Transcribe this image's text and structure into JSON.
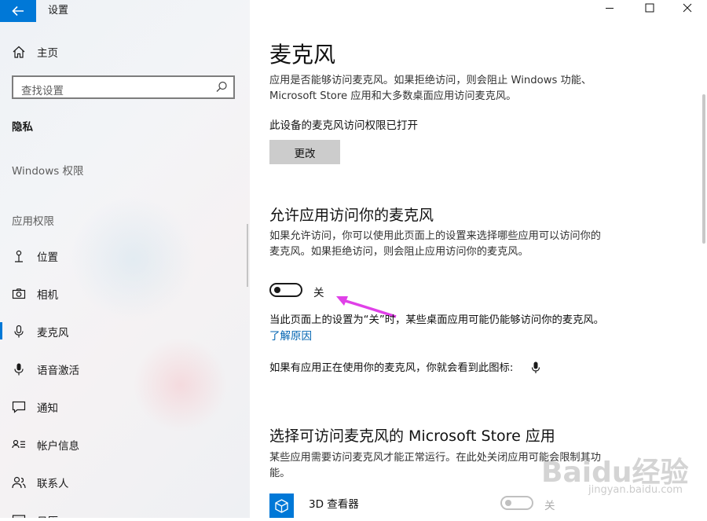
{
  "window": {
    "title": "设置"
  },
  "sidebar": {
    "home": "主页",
    "search_placeholder": "查找设置",
    "category": "隐私",
    "section_windows": "Windows 权限",
    "section_apps": "应用权限",
    "items": [
      {
        "label": "位置",
        "icon": "location-icon"
      },
      {
        "label": "相机",
        "icon": "camera-icon"
      },
      {
        "label": "麦克风",
        "icon": "microphone-icon",
        "selected": true
      },
      {
        "label": "语音激活",
        "icon": "voice-icon"
      },
      {
        "label": "通知",
        "icon": "notification-icon"
      },
      {
        "label": "帐户信息",
        "icon": "account-info-icon"
      },
      {
        "label": "联系人",
        "icon": "contacts-icon"
      },
      {
        "label": "日历",
        "icon": "calendar-icon"
      }
    ]
  },
  "main": {
    "title": "麦克风",
    "intro_line1": "应用是否能够访问麦克风。如果拒绝访问，则会阻止 Windows 功能、",
    "intro_line2": "Microsoft Store 应用和大多数桌面应用访问麦克风。",
    "device_status": "此设备的麦克风访问权限已打开",
    "change_button": "更改",
    "allow_title": "允许应用访问你的麦克风",
    "allow_desc1": "如果允许访问，你可以使用此页面上的设置来选择哪些应用可以访问你的",
    "allow_desc2": "麦克风。如果拒绝访问，则会阻止应用访问你的麦克风。",
    "toggle_label": "关",
    "toggle_on": false,
    "note": "当此页面上的设置为“关”时，某些桌面应用可能仍能够访问你的麦克风。",
    "learn_more": "了解原因",
    "indicator_note": "如果有应用正在使用你的麦克风，你就会看到此图标:",
    "store_title": "选择可访问麦克风的 Microsoft Store 应用",
    "store_desc1": "某些应用需要访问麦克风才能正常运行。在此处关闭应用可能会限制其功",
    "store_desc2": "能。",
    "apps": [
      {
        "name": "3D 查看器",
        "toggle_label": "关",
        "toggle_on": false
      }
    ]
  },
  "colors": {
    "accent": "#0078d7",
    "annotation_arrow": "#e040e8"
  },
  "watermark": {
    "brand": "Baidu经验",
    "url": "jingyan.baidu.com"
  }
}
